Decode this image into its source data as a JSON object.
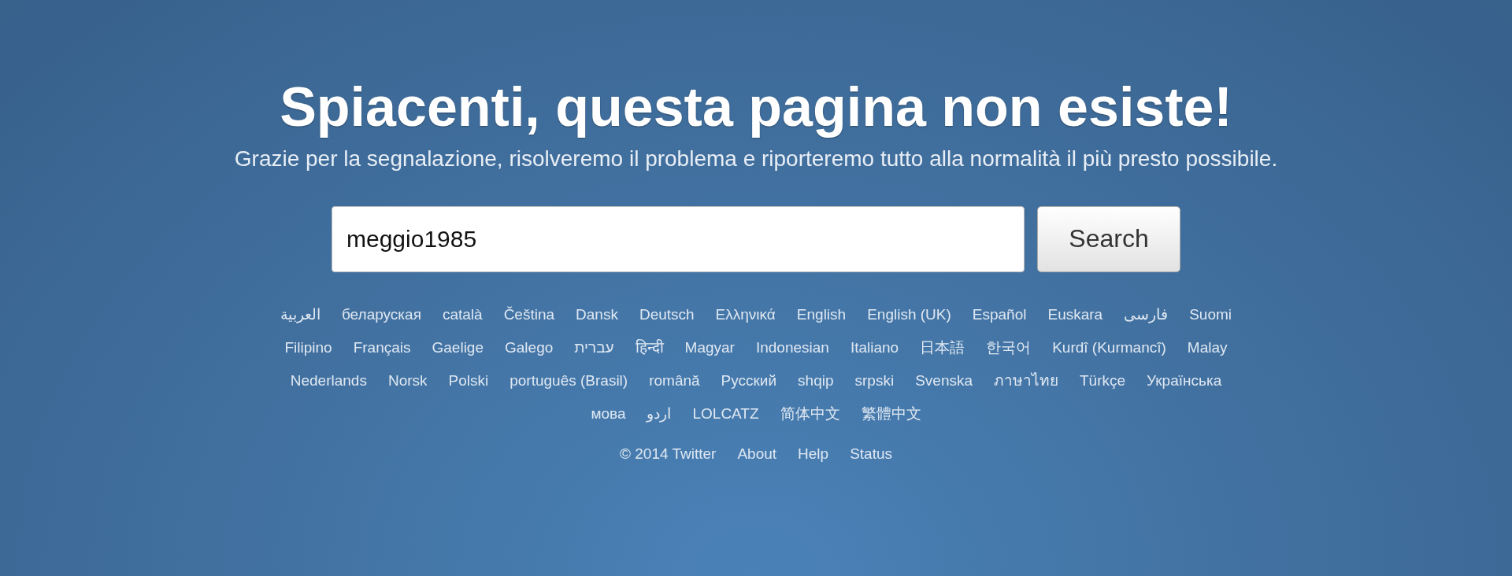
{
  "heading": "Spiacenti, questa pagina non esiste!",
  "subtitle": "Grazie per la segnalazione, risolveremo il problema e riporteremo tutto alla normalità il più presto possibile.",
  "search": {
    "value": "meggio1985",
    "button": "Search"
  },
  "languages": [
    [
      "العربية",
      "беларуская",
      "català",
      "Čeština",
      "Dansk",
      "Deutsch",
      "Ελληνικά",
      "English",
      "English (UK)",
      "Español",
      "Euskara",
      "فارسی",
      "Suomi"
    ],
    [
      "Filipino",
      "Français",
      "Gaelige",
      "Galego",
      "עברית",
      "हिन्दी",
      "Magyar",
      "Indonesian",
      "Italiano",
      "日本語",
      "한국어",
      "Kurdî (Kurmancî)",
      "Malay"
    ],
    [
      "Nederlands",
      "Norsk",
      "Polski",
      "português (Brasil)",
      "română",
      "Русский",
      "shqip",
      "srpski",
      "Svenska",
      "ภาษาไทย",
      "Türkçe",
      "Українська"
    ],
    [
      "мова",
      "اردو",
      "LOLCATZ",
      "简体中文",
      "繁體中文"
    ]
  ],
  "footer": {
    "copyright": "© 2014 Twitter",
    "links": [
      "About",
      "Help",
      "Status"
    ]
  }
}
